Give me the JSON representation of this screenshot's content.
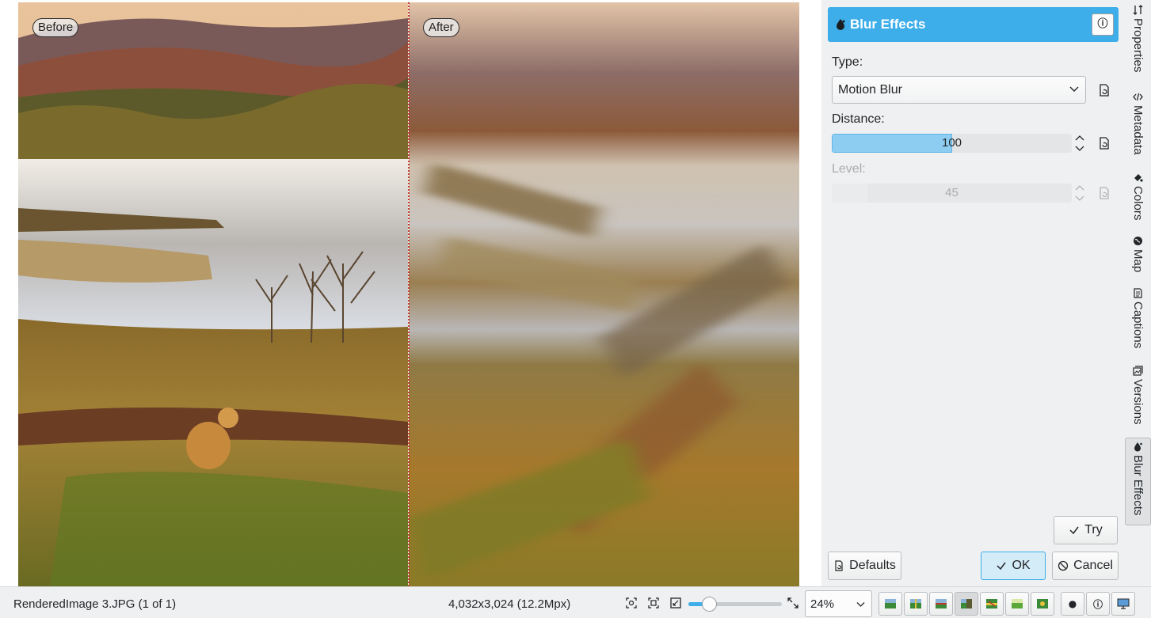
{
  "preview": {
    "before_label": "Before",
    "after_label": "After"
  },
  "panel": {
    "title": "Blur Effects",
    "type_label": "Type:",
    "type_value": "Motion Blur",
    "distance_label": "Distance:",
    "distance_value": "100",
    "distance_fraction": 0.5,
    "level_label": "Level:",
    "level_value": "45",
    "level_fraction": 0.15,
    "try_label": "Try",
    "defaults_label": "Defaults",
    "ok_label": "OK",
    "cancel_label": "Cancel"
  },
  "right_tabs": [
    {
      "label": "Properties",
      "icon": "properties-icon"
    },
    {
      "label": "Metadata",
      "icon": "metadata-icon"
    },
    {
      "label": "Colors",
      "icon": "colors-icon"
    },
    {
      "label": "Map",
      "icon": "globe-icon"
    },
    {
      "label": "Captions",
      "icon": "captions-icon"
    },
    {
      "label": "Versions",
      "icon": "versions-icon"
    },
    {
      "label": "Blur Effects",
      "icon": "blur-icon",
      "active": true
    }
  ],
  "status": {
    "filename": "RenderedImage 3.JPG (1 of 1)",
    "dimensions": "4,032x3,024 (12.2Mpx)",
    "zoom_value": "24%",
    "zoom_fraction": 0.22
  },
  "colors": {
    "accent": "#3daee9",
    "split_line": "#c0392b"
  }
}
